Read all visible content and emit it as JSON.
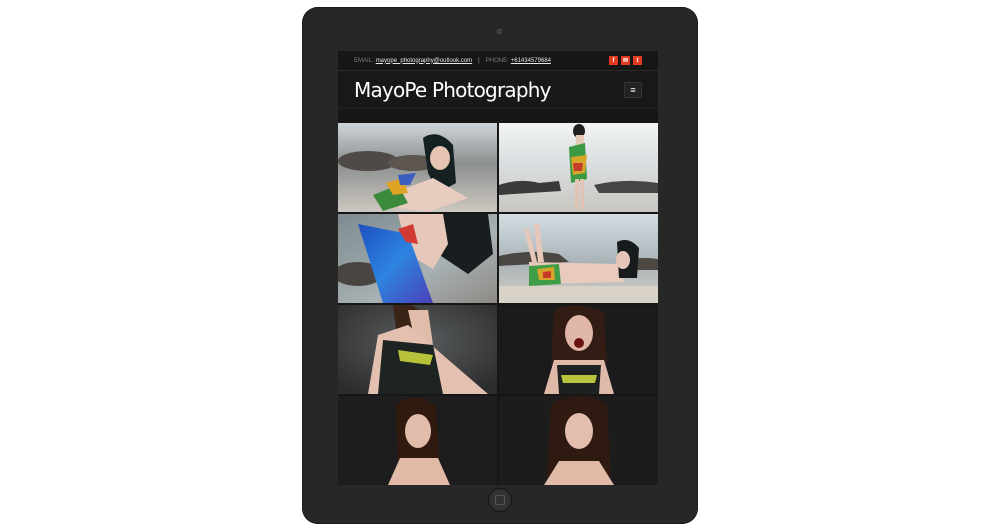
{
  "topbar": {
    "email_label": "EMAIL:",
    "email_value": "mayope_photography@outlook.com",
    "separator": "|",
    "phone_label": "PHONE:",
    "phone_value": "+61434579684",
    "social": [
      {
        "icon": "facebook-icon",
        "glyph": "f"
      },
      {
        "icon": "email-icon",
        "glyph": "✉"
      },
      {
        "icon": "tumblr-icon",
        "glyph": "t"
      }
    ]
  },
  "header": {
    "site_title": "MayoPe Photography",
    "menu_glyph": "≡"
  },
  "colors": {
    "accent": "#e03a21",
    "background": "#161616",
    "tablet_frame": "#272727"
  },
  "gallery": {
    "photos": [
      {
        "name": "beach-reclining-photo"
      },
      {
        "name": "beach-standing-photo"
      },
      {
        "name": "beach-closeup-photo"
      },
      {
        "name": "beach-lying-photo"
      },
      {
        "name": "studio-side-photo"
      },
      {
        "name": "studio-shout-photo"
      },
      {
        "name": "studio-portrait-photo"
      },
      {
        "name": "studio-front-photo"
      }
    ]
  }
}
